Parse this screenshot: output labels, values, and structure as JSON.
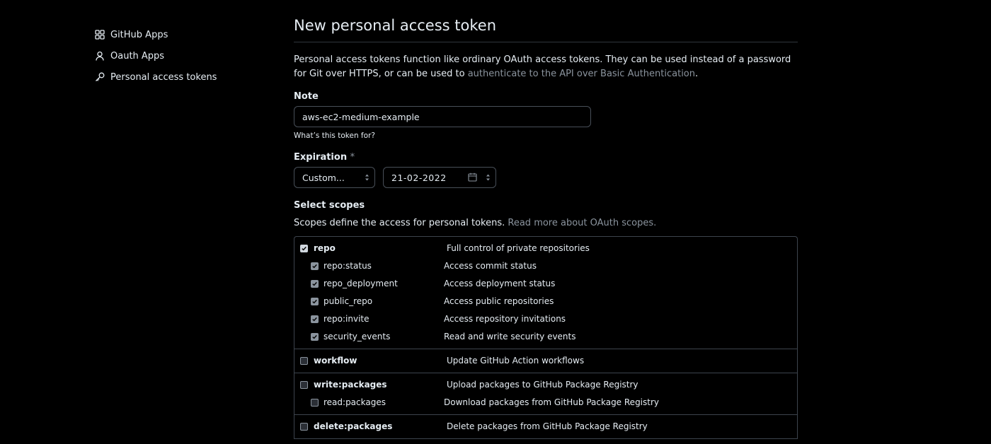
{
  "sidebar": {
    "items": [
      {
        "label": "GitHub Apps",
        "icon": "apps-grid-icon"
      },
      {
        "label": "Oauth Apps",
        "icon": "person-icon"
      },
      {
        "label": "Personal access tokens",
        "icon": "key-icon"
      }
    ]
  },
  "main": {
    "title": "New personal access token",
    "intro_text_1": "Personal access tokens function like ordinary OAuth access tokens. They can be used instead of a password for Git over HTTPS, or can be used to ",
    "intro_link": "authenticate to the API over Basic Authentication",
    "intro_text_2": ".",
    "note": {
      "label": "Note",
      "value": "aws-ec2-medium-example",
      "hint": "What’s this token for?"
    },
    "expiration": {
      "label": "Expiration",
      "required_mark": "*",
      "selected": "Custom...",
      "date": "21-02-2022"
    },
    "scopes": {
      "label": "Select scopes",
      "desc_text": "Scopes define the access for personal tokens. ",
      "desc_link": "Read more about OAuth scopes.",
      "groups": [
        {
          "name": "repo",
          "desc": "Full control of private repositories",
          "checked": true,
          "children": [
            {
              "name": "repo:status",
              "desc": "Access commit status",
              "checked": true
            },
            {
              "name": "repo_deployment",
              "desc": "Access deployment status",
              "checked": true
            },
            {
              "name": "public_repo",
              "desc": "Access public repositories",
              "checked": true
            },
            {
              "name": "repo:invite",
              "desc": "Access repository invitations",
              "checked": true
            },
            {
              "name": "security_events",
              "desc": "Read and write security events",
              "checked": true
            }
          ]
        },
        {
          "name": "workflow",
          "desc": "Update GitHub Action workflows",
          "checked": false,
          "children": []
        },
        {
          "name": "write:packages",
          "desc": "Upload packages to GitHub Package Registry",
          "checked": false,
          "children": [
            {
              "name": "read:packages",
              "desc": "Download packages from GitHub Package Registry",
              "checked": false
            }
          ]
        },
        {
          "name": "delete:packages",
          "desc": "Delete packages from GitHub Package Registry",
          "checked": false,
          "children": []
        }
      ]
    }
  },
  "colors": {
    "background": "#000000",
    "text": "#e6edf3",
    "muted": "#8b949e",
    "border": "#3d444d"
  }
}
